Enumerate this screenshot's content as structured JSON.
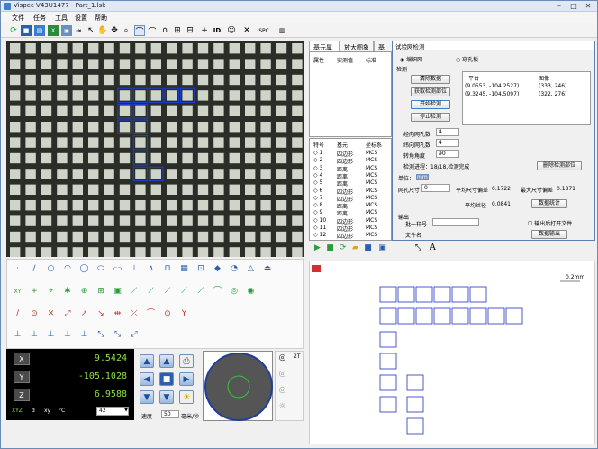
{
  "window": {
    "title": "Vispec V43U1477 - Part_1.lsk"
  },
  "menu": [
    "文件",
    "任务",
    "工具",
    "设置",
    "帮助"
  ],
  "toolbar": {
    "spc_label": "SPC",
    "id_label": "ID"
  },
  "tabs": [
    "基元属性",
    "放大图象",
    "基元"
  ],
  "prop_table": {
    "headers": [
      "属性",
      "实测值",
      "标准"
    ]
  },
  "feature_list": {
    "headers": [
      "特号",
      "基元",
      "坐标系"
    ],
    "rows": [
      [
        "1",
        "四边形",
        "MCS"
      ],
      [
        "2",
        "四边形",
        "MCS"
      ],
      [
        "3",
        "距离",
        "MCS"
      ],
      [
        "4",
        "距离",
        "MCS"
      ],
      [
        "5",
        "距离",
        "MCS"
      ],
      [
        "6",
        "四边形",
        "MCS"
      ],
      [
        "7",
        "四边形",
        "MCS"
      ],
      [
        "8",
        "距离",
        "MCS"
      ],
      [
        "9",
        "距离",
        "MCS"
      ],
      [
        "10",
        "四边形",
        "MCS"
      ],
      [
        "11",
        "四边形",
        "MCS"
      ],
      [
        "12",
        "四边形",
        "MCS"
      ]
    ]
  },
  "dialog": {
    "title": "试验网检测",
    "radio_mesh": "编织网",
    "radio_hole": "穿孔板",
    "section_detect": "检测",
    "btn_clear": "清除数据",
    "btn_get_position": "获取检测部位",
    "btn_start": "开始检测",
    "btn_stop": "停止检测",
    "table_headers": [
      "平台",
      "图像"
    ],
    "table_rows": [
      [
        "(9.0553, -104.2527)",
        "(333, 246)"
      ],
      [
        "(9.3245, -104.5097)",
        "(322, 276)"
      ]
    ],
    "label_warp": "经向网孔数",
    "value_warp": "4",
    "label_weft": "纬向网孔数",
    "value_weft": "4",
    "label_angle": "转角角度",
    "value_angle": "90",
    "progress_text": "检测进程：18/18,检测完成",
    "btn_delete_position": "删除检测部位",
    "label_unit": "单位：",
    "unit_value": "mm",
    "label_aperture": "网孔尺寸",
    "value_aperture": "0",
    "label_avg_aperture": "平均尺寸偏差",
    "value_avg_aperture": "0.1722",
    "label_max_aperture": "最大尺寸偏差",
    "value_max_aperture": "0.1871",
    "label_avg_wire": "平均丝径",
    "value_avg_wire": "0.0841",
    "btn_statistics": "数据统计",
    "label_output": "输出",
    "label_batch": "批一样号",
    "label_filename": "文件名",
    "check_open_after": "输出后打开文件",
    "btn_export": "数据输出"
  },
  "dro": {
    "x_label": "X",
    "x_value": "9.5424",
    "y_label": "Y",
    "y_value": "-105.1028",
    "z_label": "Z",
    "z_value": "6.9588",
    "units_icons": [
      "XYZ",
      "d",
      "xy",
      "°C"
    ],
    "select_value": "42"
  },
  "jog": {
    "speed_label": "速度",
    "speed_value": "50",
    "speed_unit": "毫米/秒"
  },
  "zoom": {
    "label": "2T"
  },
  "graph": {
    "scale_label": "0.2mm"
  }
}
